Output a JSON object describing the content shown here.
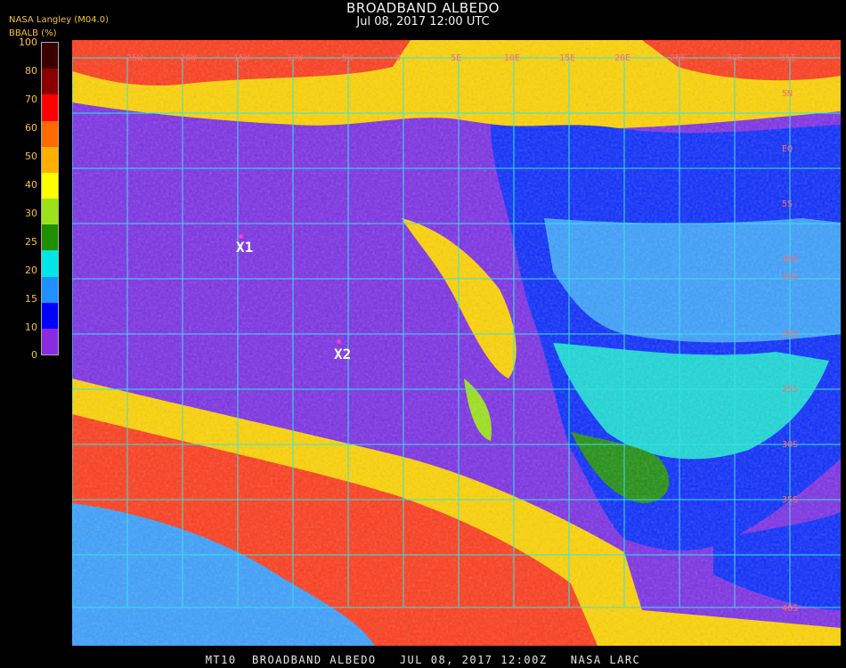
{
  "header": {
    "title": "BROADBAND ALBEDO",
    "subtitle": "Jul 08, 2017 12:00 UTC",
    "producer": "NASA Langley (M04.0)"
  },
  "colorbar": {
    "label": "BBALB (%)",
    "ticks": [
      "100",
      "80",
      "70",
      "60",
      "50",
      "40",
      "30",
      "25",
      "20",
      "15",
      "10",
      "0"
    ],
    "colors": [
      "#3a0000",
      "#8b0000",
      "#ff0000",
      "#ff6a00",
      "#ffb000",
      "#ffff00",
      "#9be21a",
      "#1f8f00",
      "#00e5e5",
      "#1e90ff",
      "#0000ff",
      "#8a2be2"
    ]
  },
  "map": {
    "colors": {
      "ocean": "#7b2ee6",
      "cloud_low": "#18d8d8",
      "cloud_mid": "#3aa0ff",
      "cloud_deep": "#0a2bff",
      "vegetation": "#1e8f10",
      "bright": "#ffd400",
      "hot": "#ff3a1a",
      "grid": "#35e3e3"
    },
    "lat_labels": [
      "5N",
      "EQ",
      "5S",
      "10S",
      "15S",
      "20S",
      "25S",
      "30S",
      "35S",
      "40S"
    ],
    "lon_labels": [
      "25W",
      "20W",
      "15W",
      "10W",
      "5W",
      "0",
      "5E",
      "10E",
      "15E",
      "20E",
      "25E",
      "30E",
      "35E"
    ],
    "markers": [
      {
        "label": "X1"
      },
      {
        "label": "X2"
      }
    ]
  },
  "footer": {
    "text": "MT10  BROADBAND ALBEDO   JUL 08, 2017 12:00Z   NASA LARC"
  }
}
